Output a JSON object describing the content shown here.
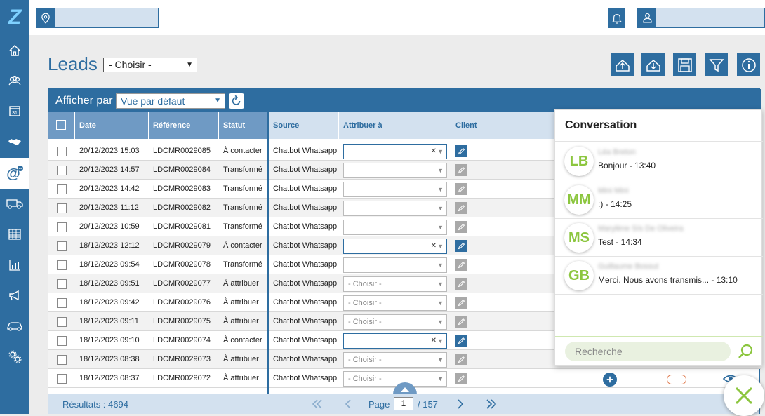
{
  "app": {
    "logo": "Z"
  },
  "sidebar": {
    "items": [
      {
        "icon": "home-icon"
      },
      {
        "icon": "team-icon"
      },
      {
        "icon": "calendar-icon",
        "label": "31"
      },
      {
        "icon": "handshake-icon"
      },
      {
        "icon": "at-icon",
        "active": true
      },
      {
        "icon": "truck-icon"
      },
      {
        "icon": "table-icon"
      },
      {
        "icon": "chart-icon"
      },
      {
        "icon": "megaphone-icon"
      },
      {
        "icon": "car-icon"
      },
      {
        "icon": "settings-icon"
      }
    ]
  },
  "topbar": {
    "location_value": "",
    "user_value": ""
  },
  "page": {
    "title": "Leads",
    "filter_select": "- Choisir -"
  },
  "toolbar": [
    "export-icon",
    "download-icon",
    "save-icon",
    "filter-icon",
    "info-icon"
  ],
  "grid": {
    "display_label": "Afficher par",
    "view_select": "Vue par défaut",
    "columns": [
      "Date",
      "Référence",
      "Statut",
      "Source",
      "Attribuer à",
      "Client"
    ],
    "rows": [
      {
        "date": "20/12/2023 15:03",
        "ref": "LDCMR0029085",
        "status": "À contacter",
        "source": "Chatbot Whatsapp",
        "assign": "",
        "clearable": true,
        "edit_active": true
      },
      {
        "date": "20/12/2023 14:57",
        "ref": "LDCMR0029084",
        "status": "Transformé",
        "source": "Chatbot Whatsapp",
        "assign": "",
        "clearable": false,
        "edit_active": false
      },
      {
        "date": "20/12/2023 14:42",
        "ref": "LDCMR0029083",
        "status": "Transformé",
        "source": "Chatbot Whatsapp",
        "assign": "",
        "clearable": false,
        "edit_active": false
      },
      {
        "date": "20/12/2023 11:12",
        "ref": "LDCMR0029082",
        "status": "Transformé",
        "source": "Chatbot Whatsapp",
        "assign": "",
        "clearable": false,
        "edit_active": false
      },
      {
        "date": "20/12/2023 10:59",
        "ref": "LDCMR0029081",
        "status": "Transformé",
        "source": "Chatbot Whatsapp",
        "assign": "",
        "clearable": false,
        "edit_active": false
      },
      {
        "date": "18/12/2023 12:12",
        "ref": "LDCMR0029079",
        "status": "À contacter",
        "source": "Chatbot Whatsapp",
        "assign": "",
        "clearable": true,
        "edit_active": true
      },
      {
        "date": "18/12/2023 09:54",
        "ref": "LDCMR0029078",
        "status": "Transformé",
        "source": "Chatbot Whatsapp",
        "assign": "",
        "clearable": false,
        "edit_active": false
      },
      {
        "date": "18/12/2023 09:51",
        "ref": "LDCMR0029077",
        "status": "À attribuer",
        "source": "Chatbot Whatsapp",
        "assign": "- Choisir -",
        "clearable": false,
        "edit_active": false
      },
      {
        "date": "18/12/2023 09:42",
        "ref": "LDCMR0029076",
        "status": "À attribuer",
        "source": "Chatbot Whatsapp",
        "assign": "- Choisir -",
        "clearable": false,
        "edit_active": false
      },
      {
        "date": "18/12/2023 09:11",
        "ref": "LDCMR0029075",
        "status": "À attribuer",
        "source": "Chatbot Whatsapp",
        "assign": "- Choisir -",
        "clearable": false,
        "edit_active": false
      },
      {
        "date": "18/12/2023 09:10",
        "ref": "LDCMR0029074",
        "status": "À contacter",
        "source": "Chatbot Whatsapp",
        "assign": "",
        "clearable": true,
        "edit_active": true
      },
      {
        "date": "18/12/2023 08:38",
        "ref": "LDCMR0029073",
        "status": "À attribuer",
        "source": "Chatbot Whatsapp",
        "assign": "- Choisir -",
        "clearable": false,
        "edit_active": false
      },
      {
        "date": "18/12/2023 08:37",
        "ref": "LDCMR0029072",
        "status": "À attribuer",
        "source": "Chatbot Whatsapp",
        "assign": "- Choisir -",
        "clearable": false,
        "edit_active": false
      }
    ],
    "footer": {
      "results": "Résultats : 4694",
      "page_label": "Page",
      "page_value": "1",
      "page_total": "/ 157"
    }
  },
  "conversation": {
    "title": "Conversation",
    "items": [
      {
        "initials": "LB",
        "name": "Léa Breton",
        "message": "Bonjour - 13:40"
      },
      {
        "initials": "MM",
        "name": "Mini Mini",
        "message": ":) - 14:25"
      },
      {
        "initials": "MS",
        "name": "Marylène Sís De Oliveira",
        "message": "Test - 14:34"
      },
      {
        "initials": "GB",
        "name": "Guillaume Bossut",
        "message": "Merci. Nous avons transmis... - 13:10"
      }
    ],
    "search_placeholder": "Recherche"
  },
  "colors": {
    "primary": "#2e6da0",
    "header_dark": "#6f9ac4",
    "header_light": "#d3e1ef",
    "avatar_green": "#8cc63f"
  }
}
